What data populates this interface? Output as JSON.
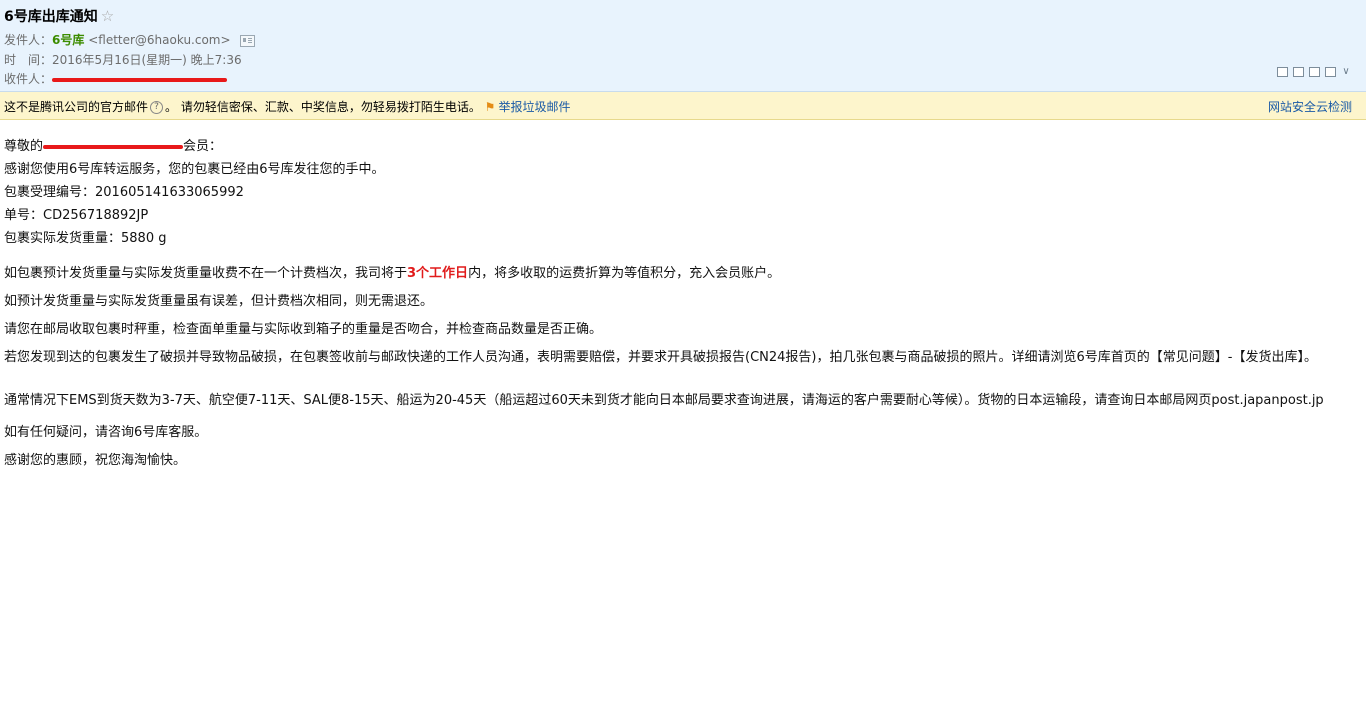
{
  "mail": {
    "subject": "6号库出库通知",
    "star_glyph": "☆",
    "from_label": "发件人：",
    "from_name": "6号库",
    "from_addr": "<fletter@6haoku.com>",
    "time_label": "时　间：",
    "time_value": "2016年5月16日(星期一) 晚上7:36",
    "to_label": "收件人："
  },
  "warning": {
    "text1": "这不是腾讯公司的官方邮件",
    "text2": "。 请勿轻信密保、汇款、中奖信息，勿轻易拨打陌生电话。",
    "report_label": "举报垃圾邮件",
    "security_link": "网站安全云检测"
  },
  "body": {
    "greet_prefix": "尊敬的",
    "greet_suffix": "会员：",
    "l1": "感谢您使用6号库转运服务，您的包裹已经由6号库发往您的手中。",
    "l2": "包裹受理编号：201605141633065992",
    "l3": "单号：CD256718892JP",
    "l4": "包裹实际发货重量：5880 g",
    "p1_a": "如包裹预计发货重量与实际发货重量收费不在一个计费档次，我司将于",
    "p1_red": "3个工作日",
    "p1_b": "内，将多收取的运费折算为等值积分，充入会员账户。",
    "p2": "如预计发货重量与实际发货重量虽有误差，但计费档次相同，则无需退还。",
    "p3": "请您在邮局收取包裹时秤重，检查面单重量与实际收到箱子的重量是否吻合，并检查商品数量是否正确。",
    "p4": "若您发现到达的包裹发生了破损并导致物品破损，在包裹签收前与邮政快递的工作人员沟通，表明需要赔偿，并要求开具破损报告(CN24报告)，拍几张包裹与商品破损的照片。详细请浏览6号库首页的【常见问题】-【发货出库】。",
    "p5": "通常情况下EMS到货天数为3-7天、航空便7-11天、SAL便8-15天、船运为20-45天（船运超过60天未到货才能向日本邮局要求查询进展，请海运的客户需要耐心等候）。货物的日本运输段，请查询日本邮局网页post.japanpost.jp",
    "p6": "如有任何疑问，请咨询6号库客服。",
    "p7": "感谢您的惠顾，祝您海淘愉快。"
  },
  "colors": {
    "header_bg": "#e8f3fd",
    "warning_bg": "#fdf5cc",
    "sender_name": "#3c8c00",
    "link": "#1a5aa6",
    "highlight_red": "#e11b1b",
    "redaction": "#e8191a"
  },
  "icons": [
    "star-icon",
    "contact-card-icon",
    "help-icon",
    "report-flag-icon",
    "new-window-icon",
    "print-icon",
    "more-icon"
  ]
}
